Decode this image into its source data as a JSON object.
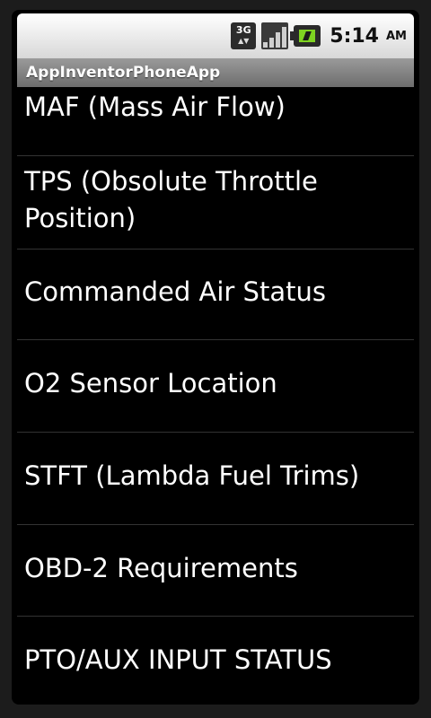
{
  "status_bar": {
    "network_label": "3G",
    "time": "5:14",
    "ampm": "AM",
    "icons": [
      "network-3g-icon",
      "signal-strength-icon",
      "battery-charging-icon"
    ]
  },
  "app": {
    "title": "AppInventorPhoneApp"
  },
  "list": {
    "items": [
      {
        "label": "MAF (Mass Air Flow)"
      },
      {
        "label": "TPS (Obsolute Throttle Position)"
      },
      {
        "label": "Commanded Air Status"
      },
      {
        "label": "O2 Sensor Location"
      },
      {
        "label": "STFT (Lambda Fuel Trims)"
      },
      {
        "label": "OBD-2 Requirements"
      },
      {
        "label": "PTO/AUX INPUT STATUS"
      }
    ]
  },
  "colors": {
    "list_background": "#000000",
    "divider": "#333333",
    "text": "#ffffff"
  }
}
